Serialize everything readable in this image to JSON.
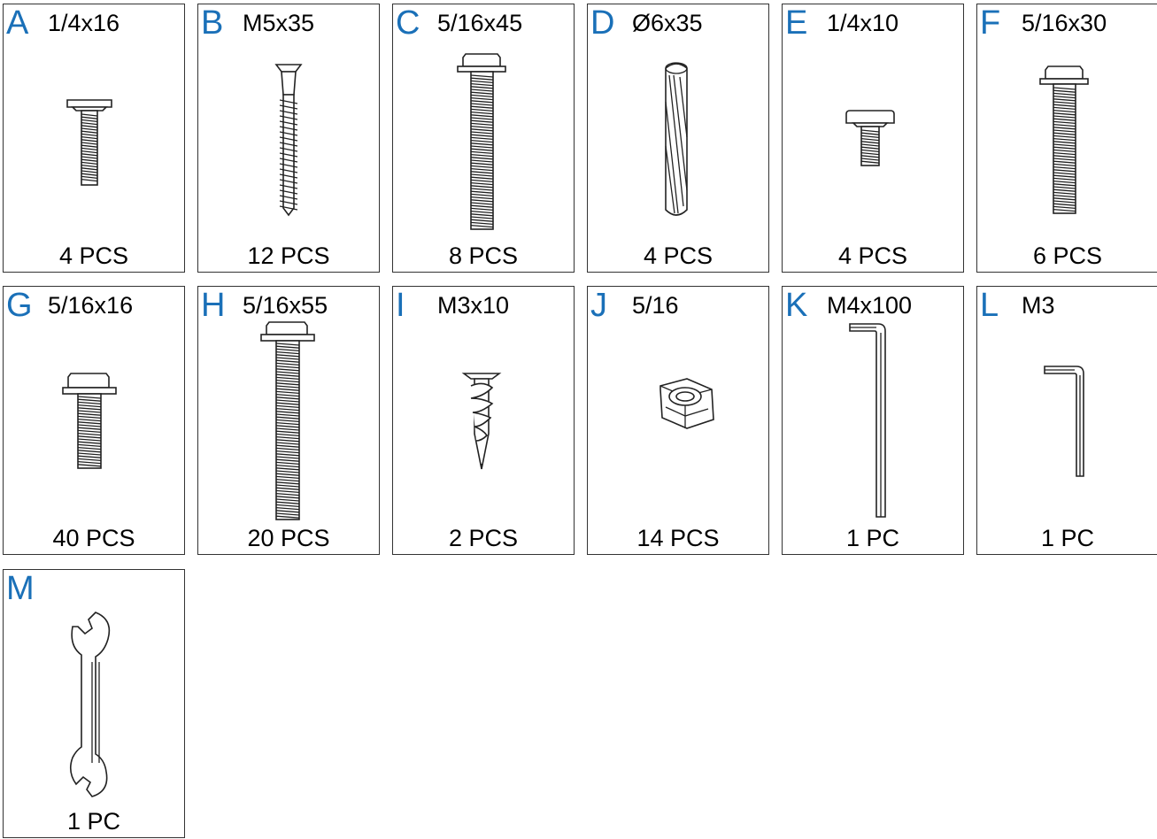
{
  "parts": [
    {
      "letter": "A",
      "size": "1/4x16",
      "qty": "4 PCS",
      "icon": "pan-head-bolt-icon"
    },
    {
      "letter": "B",
      "size": "M5x35",
      "qty": "12 PCS",
      "icon": "wood-screw-icon"
    },
    {
      "letter": "C",
      "size": "5/16x45",
      "qty": "8 PCS",
      "icon": "washer-head-bolt-icon"
    },
    {
      "letter": "D",
      "size": "Ø6x35",
      "qty": "4 PCS",
      "icon": "wood-dowel-icon"
    },
    {
      "letter": "E",
      "size": "1/4x10",
      "qty": "4 PCS",
      "icon": "short-bolt-icon"
    },
    {
      "letter": "F",
      "size": "5/16x30",
      "qty": "6 PCS",
      "icon": "washer-head-bolt-icon"
    },
    {
      "letter": "G",
      "size": "5/16x16",
      "qty": "40 PCS",
      "icon": "washer-head-bolt-icon"
    },
    {
      "letter": "H",
      "size": "5/16x55",
      "qty": "20 PCS",
      "icon": "long-bolt-icon"
    },
    {
      "letter": "I",
      "size": "M3x10",
      "qty": "2 PCS",
      "icon": "drywall-anchor-icon"
    },
    {
      "letter": "J",
      "size": "5/16",
      "qty": "14 PCS",
      "icon": "lock-nut-icon"
    },
    {
      "letter": "K",
      "size": "M4x100",
      "qty": "1 PC",
      "icon": "allen-key-icon"
    },
    {
      "letter": "L",
      "size": "M3",
      "qty": "1 PC",
      "icon": "small-allen-key-icon"
    },
    {
      "letter": "M",
      "size": "",
      "qty": "1 PC",
      "icon": "wrench-icon"
    }
  ],
  "colors": {
    "letter": "#1a70b8",
    "border": "#333333",
    "line": "#222222"
  }
}
